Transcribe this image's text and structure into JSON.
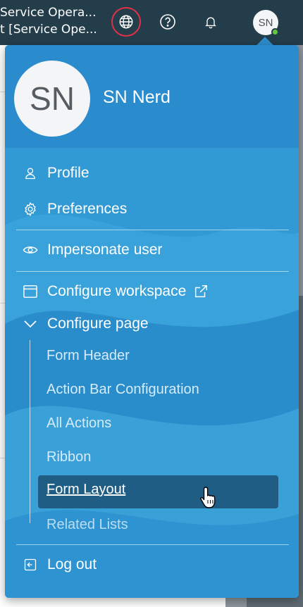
{
  "topbar": {
    "title_line1": "Service Opera...",
    "title_line2": "t [Service Ope...",
    "globe_icon": "globe-icon",
    "help_icon": "question-icon",
    "bell_icon": "bell-icon",
    "avatar_initials": "SN",
    "ring_color": "#e0304a"
  },
  "menu": {
    "header": {
      "avatar_initials": "SN",
      "user_name": "SN Nerd"
    },
    "items": {
      "profile": "Profile",
      "preferences": "Preferences",
      "impersonate": "Impersonate user",
      "configure_workspace": "Configure workspace",
      "configure_page": "Configure page",
      "log_out": "Log out"
    },
    "configure_page_submenu": [
      "Form Header",
      "Action Bar Configuration",
      "All Actions",
      "Ribbon",
      "Form Layout",
      "Related Lists"
    ],
    "selected_submenu_item": "Form Layout"
  }
}
